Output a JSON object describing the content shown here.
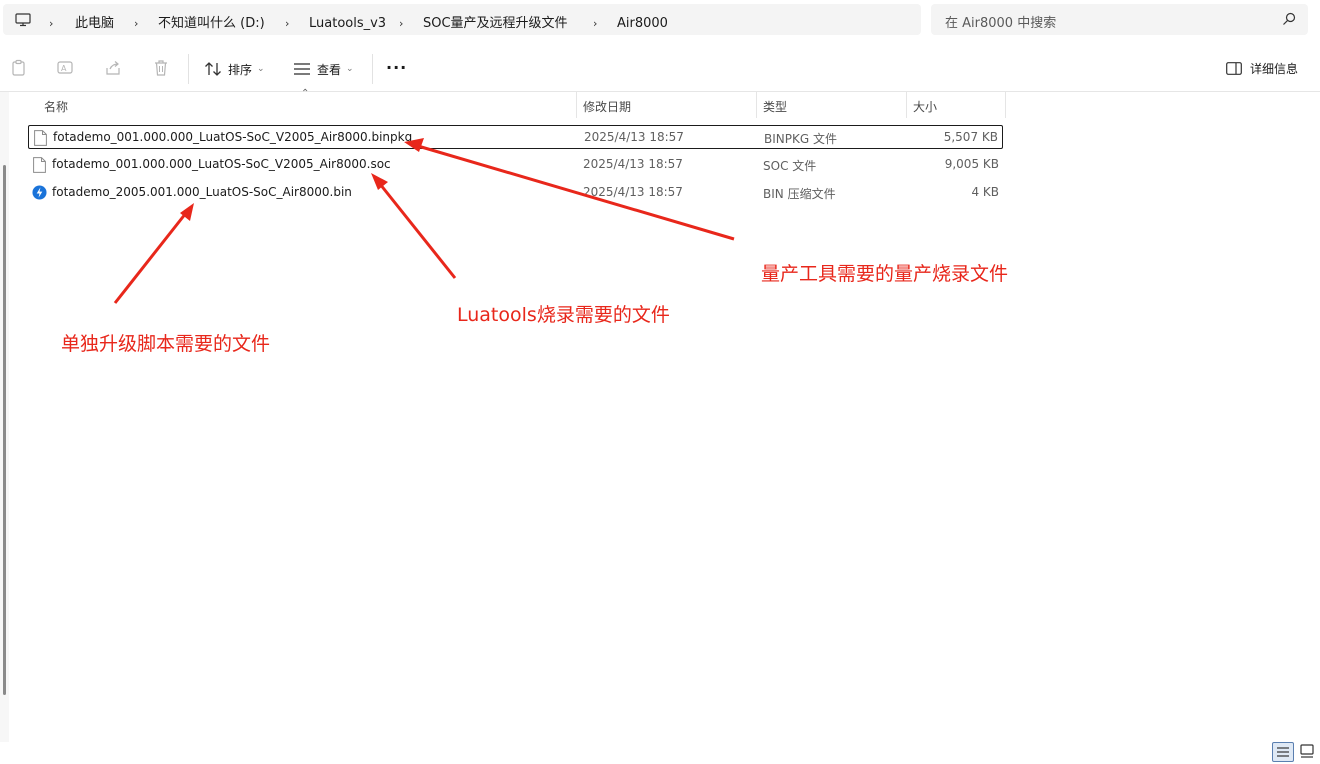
{
  "breadcrumb": {
    "items": [
      "此电脑",
      "不知道叫什么 (D:)",
      "Luatools_v3",
      "SOC量产及远程升级文件",
      "Air8000"
    ]
  },
  "search": {
    "placeholder": "在 Air8000 中搜索"
  },
  "toolbar": {
    "sort_label": "排序",
    "view_label": "查看",
    "more_label": "···",
    "details_label": "详细信息"
  },
  "columns": {
    "name": "名称",
    "date": "修改日期",
    "type": "类型",
    "size": "大小"
  },
  "files": [
    {
      "name": "fotademo_001.000.000_LuatOS-SoC_V2005_Air8000.binpkg",
      "date": "2025/4/13 18:57",
      "type": "BINPKG 文件",
      "size": "5,507 KB"
    },
    {
      "name": "fotademo_001.000.000_LuatOS-SoC_V2005_Air8000.soc",
      "date": "2025/4/13 18:57",
      "type": "SOC 文件",
      "size": "9,005 KB"
    },
    {
      "name": "fotademo_2005.001.000_LuatOS-SoC_Air8000.bin",
      "date": "2025/4/13 18:57",
      "type": "BIN 压缩文件",
      "size": "4 KB"
    }
  ],
  "annotations": {
    "binpkg_note": "量产工具需要的量产烧录文件",
    "soc_note": "Luatools烧录需要的文件",
    "bin_note": "单独升级脚本需要的文件"
  },
  "colors": {
    "annotation": "#e8271b",
    "accent": "#0067c0"
  }
}
